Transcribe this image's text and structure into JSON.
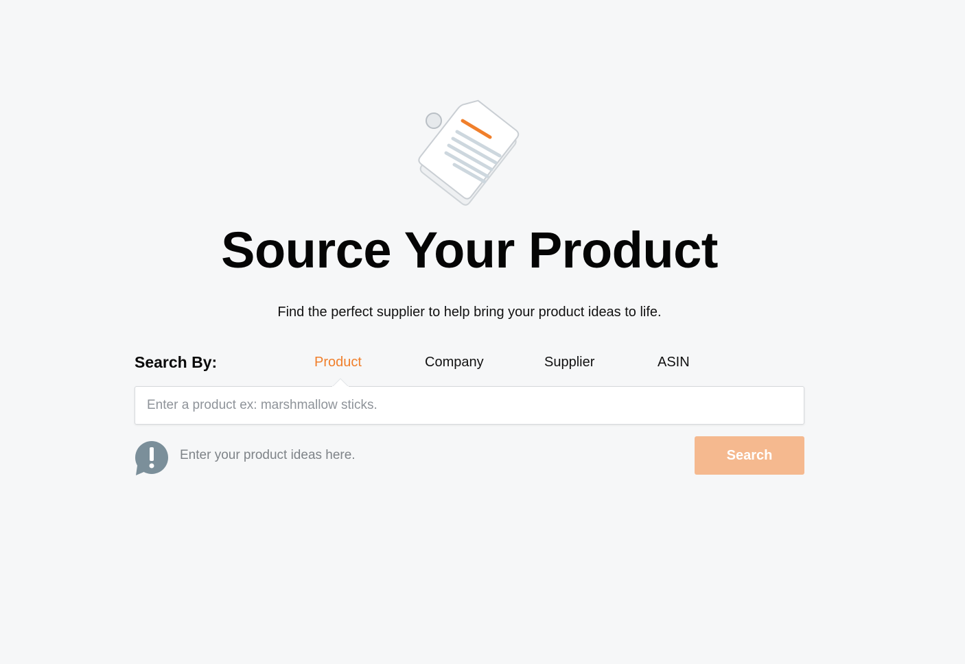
{
  "hero": {
    "icon": "price-tags-icon",
    "title": "Source Your Product",
    "subtitle": "Find the perfect supplier to help bring your product ideas to life."
  },
  "search": {
    "label": "Search By:",
    "tabs": [
      {
        "label": "Product",
        "active": true
      },
      {
        "label": "Company",
        "active": false
      },
      {
        "label": "Supplier",
        "active": false
      },
      {
        "label": "ASIN",
        "active": false
      }
    ],
    "placeholder": "Enter a product ex: marshmallow sticks.",
    "value": "",
    "hint_icon": "exclamation-bubble-icon",
    "hint": "Enter your product ideas here.",
    "button_label": "Search"
  },
  "colors": {
    "accent": "#f07f2b",
    "button_disabled": "#f5b98f",
    "background": "#f6f7f8",
    "hint_icon": "#7b8f9a"
  }
}
